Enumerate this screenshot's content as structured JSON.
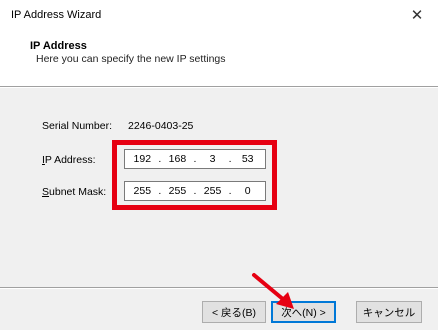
{
  "window": {
    "title": "IP Address Wizard",
    "close_glyph": "✕"
  },
  "header": {
    "title": "IP Address",
    "subtitle": "Here you can specify the new IP settings"
  },
  "form": {
    "serial_label": "Serial Number:",
    "serial_value": "2246-0403-25",
    "ip_label_first": "I",
    "ip_label_rest": "P Address:",
    "ip_octets": [
      "192",
      "168",
      "3",
      "53"
    ],
    "mask_label_first": "S",
    "mask_label_rest": "ubnet Mask:",
    "mask_octets": [
      "255",
      "255",
      "255",
      "0"
    ],
    "dot": "."
  },
  "buttons": {
    "back_label": "< 戻る(B)",
    "next_label": "次へ(N) >",
    "cancel_label": "キャンセル"
  },
  "colors": {
    "highlight": "#e60012",
    "focus": "#0078d7"
  }
}
